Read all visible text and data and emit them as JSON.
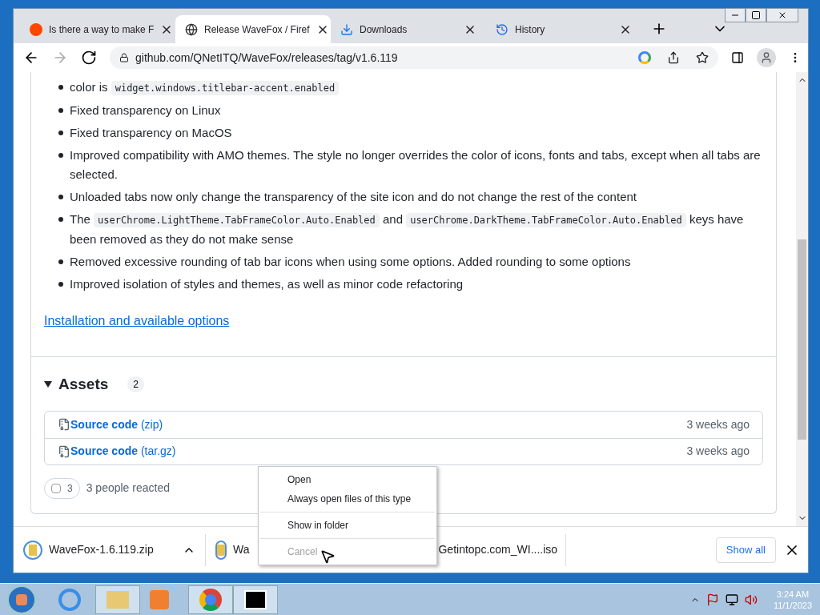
{
  "tabs": [
    {
      "title": "Is there a way to make F",
      "selected": false
    },
    {
      "title": "Release WaveFox / Firef",
      "selected": true
    },
    {
      "title": "Downloads",
      "selected": false
    },
    {
      "title": "History",
      "selected": false
    }
  ],
  "address": "github.com/QNetITQ/WaveFox/releases/tag/v1.6.119",
  "bullets": [
    {
      "parts": [
        {
          "t": "color is "
        },
        {
          "code": "widget.windows.titlebar-accent.enabled"
        }
      ]
    },
    {
      "parts": [
        {
          "t": "Fixed transparency on Linux"
        }
      ]
    },
    {
      "parts": [
        {
          "t": "Fixed transparency on MacOS"
        }
      ]
    },
    {
      "parts": [
        {
          "t": "Improved compatibility with AMO themes. The style no longer overrides the color of icons, fonts and tabs, except when all tabs are selected."
        }
      ]
    },
    {
      "parts": [
        {
          "t": "Unloaded tabs now only change the transparency of the site icon and do not change the rest of the content"
        }
      ]
    },
    {
      "parts": [
        {
          "t": "The "
        },
        {
          "code": "userChrome.LightTheme.TabFrameColor.Auto.Enabled"
        },
        {
          "t": " and "
        },
        {
          "code": "userChrome.DarkTheme.TabFrameColor.Auto.Enabled"
        },
        {
          "t": " keys have been removed as they do not make sense"
        }
      ]
    },
    {
      "parts": [
        {
          "t": "Removed excessive rounding of tab bar icons when using some options. Added rounding to some options"
        }
      ]
    },
    {
      "parts": [
        {
          "t": "Improved isolation of styles and themes, as well as minor code refactoring"
        }
      ]
    }
  ],
  "link": "Installation and available options",
  "assets": {
    "title": "Assets",
    "count": "2",
    "expanded": true,
    "items": [
      {
        "name": "Source code",
        "ext": "(zip)",
        "time": "3 weeks ago"
      },
      {
        "name": "Source code",
        "ext": "(tar.gz)",
        "time": "3 weeks ago"
      }
    ]
  },
  "reactions": {
    "emoji_count": "3",
    "text": "3 people reacted"
  },
  "downloads": [
    {
      "parts": [
        "WaveFox-1.6.119.zip"
      ]
    },
    {
      "parts": [
        "Wa",
        "Getintopc.com_WI....iso"
      ]
    }
  ],
  "show_all": "Show all",
  "context_menu": [
    {
      "label": "Open",
      "disabled": false,
      "separator_before": false
    },
    {
      "label": "Always open files of this type",
      "disabled": false,
      "separator_before": false
    },
    {
      "label": "Show in folder",
      "disabled": false,
      "separator_before": true
    },
    {
      "label": "Cancel",
      "disabled": true,
      "separator_before": true
    }
  ],
  "clock": {
    "time": "3:24 AM",
    "date": "11/1/2023"
  }
}
